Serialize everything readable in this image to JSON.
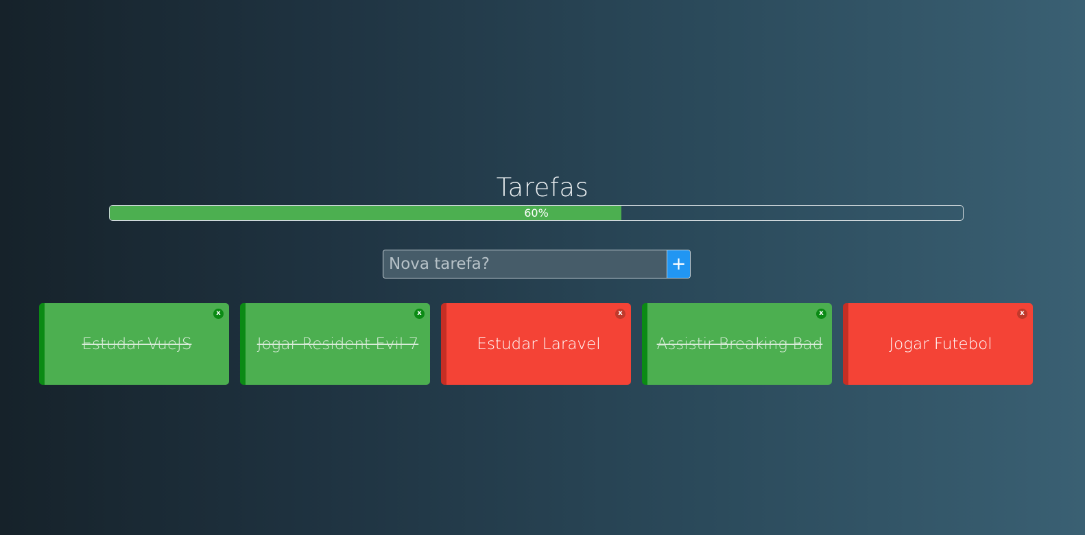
{
  "header": {
    "title": "Tarefas"
  },
  "progress": {
    "percent": 60,
    "label": "60%",
    "fill_color": "#4caf50"
  },
  "new_task": {
    "placeholder": "Nova tarefa?",
    "value": "",
    "add_label": "+"
  },
  "tasks": [
    {
      "label": "Estudar VueJS",
      "done": true,
      "close_label": "x"
    },
    {
      "label": "Jogar Resident Evil 7",
      "done": true,
      "close_label": "x"
    },
    {
      "label": "Estudar Laravel",
      "done": false,
      "close_label": "x"
    },
    {
      "label": "Assistir Breaking Bad",
      "done": true,
      "close_label": "x"
    },
    {
      "label": "Jogar Futebol",
      "done": false,
      "close_label": "x"
    }
  ],
  "colors": {
    "done": "#4caf50",
    "done_border": "#0b8a14",
    "pending": "#f44336",
    "pending_border": "#c62e24",
    "accent": "#2196f3"
  }
}
